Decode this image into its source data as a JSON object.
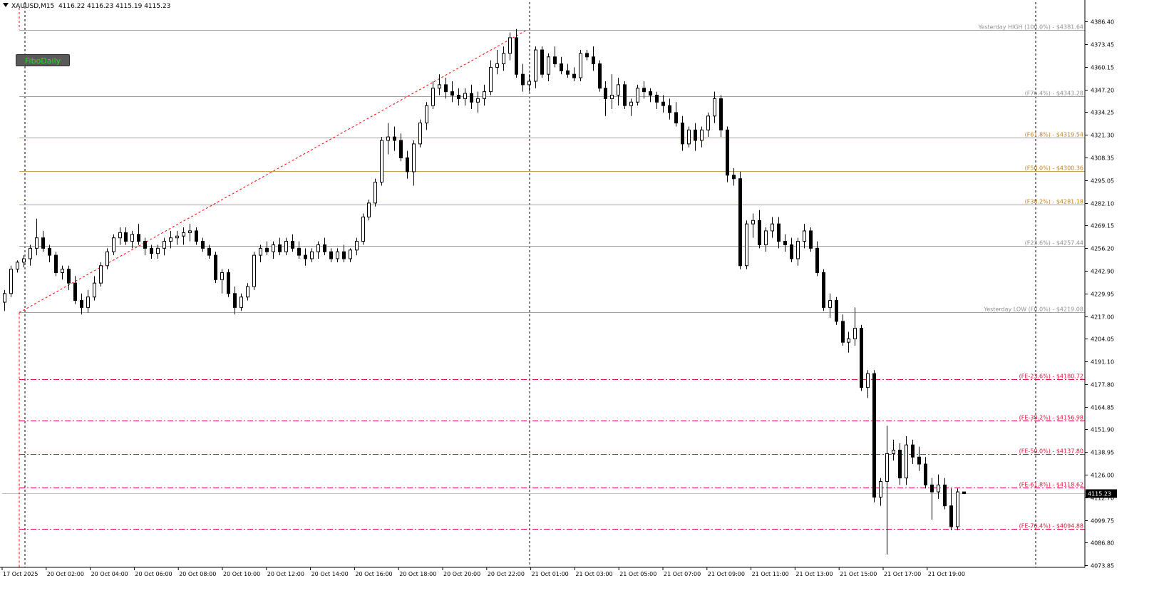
{
  "header": {
    "symbol": "XAUUSD,M15",
    "ohlc": "4116.22 4116.23 4115.19 4115.23"
  },
  "button": {
    "label": "FiboDaily"
  },
  "colors": {
    "background": "#ffffff",
    "gray_line": "#a0a0a0",
    "gold_line": "#c8a050",
    "fe_line": "#dc143c",
    "trend": "#ff0000",
    "bull": "#ffffff",
    "bear": "#000000"
  },
  "chart_data": {
    "type": "candlestick",
    "price_axis": {
      "ticks": [
        "4386.40",
        "4373.45",
        "4360.15",
        "4347.20",
        "4334.25",
        "4321.30",
        "4308.35",
        "4295.05",
        "4282.10",
        "4269.15",
        "4256.20",
        "4242.90",
        "4229.95",
        "4217.00",
        "4204.05",
        "4191.10",
        "4177.80",
        "4164.85",
        "4151.90",
        "4138.95",
        "4126.00",
        "4112.70",
        "4099.75",
        "4086.80",
        "4073.85"
      ],
      "current_price": "4115.23"
    },
    "time_axis": [
      "17 Oct 2025",
      "20 Oct 02:00",
      "20 Oct 04:00",
      "20 Oct 06:00",
      "20 Oct 08:00",
      "20 Oct 10:00",
      "20 Oct 12:00",
      "20 Oct 14:00",
      "20 Oct 16:00",
      "20 Oct 18:00",
      "20 Oct 20:00",
      "20 Oct 22:00",
      "21 Oct 01:00",
      "21 Oct 03:00",
      "21 Oct 05:00",
      "21 Oct 07:00",
      "21 Oct 09:00",
      "21 Oct 11:00",
      "21 Oct 13:00",
      "21 Oct 15:00",
      "21 Oct 17:00",
      "21 Oct 19:00"
    ],
    "levels": [
      {
        "label": "Yesterday HIGH (100.0%) - $4381.64",
        "price": 4381.64,
        "style": "gray"
      },
      {
        "label": "(F76.4%) - $4343.28",
        "price": 4343.28,
        "style": "gray"
      },
      {
        "label": "(F61.8%) - $4319.54",
        "price": 4319.54,
        "style": "gold"
      },
      {
        "label": "(F50.0%) - $4300.36",
        "price": 4300.36,
        "style": "gold"
      },
      {
        "label": "(F38.2%) - $4281.18",
        "price": 4281.18,
        "style": "gold"
      },
      {
        "label": "(F23.6%) - $4257.44",
        "price": 4257.44,
        "style": "gray"
      },
      {
        "label": "Yesterday LOW (F0.0%) - $4219.08",
        "price": 4219.08,
        "style": "gray"
      },
      {
        "label": "(FE-23.6%) - $4180.72",
        "price": 4180.72,
        "style": "fe"
      },
      {
        "label": "(FE-38.2%) - $4156.98",
        "price": 4156.98,
        "style": "fe"
      },
      {
        "label": "(FE-50.0%) - $4137.80",
        "price": 4137.8,
        "style": "fe"
      },
      {
        "label": "(FE-61.8%) - $4118.62",
        "price": 4118.62,
        "style": "fe"
      },
      {
        "label": "(FE-76.4%) - $4094.88",
        "price": 4094.88,
        "style": "fe"
      }
    ],
    "candles": [
      [
        4225,
        4232,
        4220,
        4230
      ],
      [
        4230,
        4246,
        4228,
        4244
      ],
      [
        4244,
        4249,
        4242,
        4248
      ],
      [
        4248,
        4252,
        4245,
        4250
      ],
      [
        4250,
        4258,
        4246,
        4256
      ],
      [
        4256,
        4273,
        4252,
        4262
      ],
      [
        4262,
        4266,
        4254,
        4256
      ],
      [
        4256,
        4258,
        4248,
        4252
      ],
      [
        4252,
        4254,
        4240,
        4242
      ],
      [
        4242,
        4246,
        4238,
        4244
      ],
      [
        4244,
        4246,
        4232,
        4236
      ],
      [
        4236,
        4240,
        4224,
        4226
      ],
      [
        4226,
        4230,
        4218,
        4222
      ],
      [
        4222,
        4232,
        4219,
        4228
      ],
      [
        4228,
        4240,
        4226,
        4236
      ],
      [
        4236,
        4248,
        4234,
        4246
      ],
      [
        4246,
        4256,
        4244,
        4254
      ],
      [
        4254,
        4264,
        4252,
        4262
      ],
      [
        4262,
        4268,
        4258,
        4265
      ],
      [
        4265,
        4268,
        4258,
        4260
      ],
      [
        4260,
        4266,
        4256,
        4264
      ],
      [
        4264,
        4270,
        4258,
        4260
      ],
      [
        4260,
        4262,
        4252,
        4256
      ],
      [
        4256,
        4258,
        4250,
        4253
      ],
      [
        4253,
        4258,
        4250,
        4256
      ],
      [
        4256,
        4262,
        4252,
        4260
      ],
      [
        4260,
        4266,
        4256,
        4262
      ],
      [
        4262,
        4266,
        4258,
        4263
      ],
      [
        4263,
        4268,
        4258,
        4265
      ],
      [
        4265,
        4270,
        4260,
        4266
      ],
      [
        4266,
        4268,
        4258,
        4260
      ],
      [
        4260,
        4262,
        4254,
        4256
      ],
      [
        4256,
        4258,
        4250,
        4252
      ],
      [
        4252,
        4254,
        4236,
        4238
      ],
      [
        4238,
        4244,
        4230,
        4242
      ],
      [
        4242,
        4244,
        4228,
        4230
      ],
      [
        4230,
        4234,
        4218,
        4222
      ],
      [
        4222,
        4230,
        4220,
        4228
      ],
      [
        4228,
        4236,
        4226,
        4234
      ],
      [
        4234,
        4254,
        4232,
        4252
      ],
      [
        4252,
        4258,
        4248,
        4256
      ],
      [
        4256,
        4260,
        4252,
        4254
      ],
      [
        4254,
        4260,
        4250,
        4258
      ],
      [
        4258,
        4262,
        4252,
        4254
      ],
      [
        4254,
        4262,
        4252,
        4260
      ],
      [
        4260,
        4264,
        4254,
        4256
      ],
      [
        4256,
        4260,
        4250,
        4252
      ],
      [
        4252,
        4256,
        4246,
        4250
      ],
      [
        4250,
        4256,
        4248,
        4254
      ],
      [
        4254,
        4260,
        4250,
        4258
      ],
      [
        4258,
        4262,
        4252,
        4254
      ],
      [
        4254,
        4256,
        4248,
        4250
      ],
      [
        4250,
        4256,
        4248,
        4254
      ],
      [
        4254,
        4258,
        4248,
        4250
      ],
      [
        4250,
        4256,
        4248,
        4255
      ],
      [
        4255,
        4262,
        4252,
        4260
      ],
      [
        4260,
        4276,
        4258,
        4274
      ],
      [
        4274,
        4284,
        4272,
        4282
      ],
      [
        4282,
        4296,
        4280,
        4294
      ],
      [
        4294,
        4320,
        4292,
        4318
      ],
      [
        4318,
        4328,
        4310,
        4320
      ],
      [
        4320,
        4326,
        4312,
        4318
      ],
      [
        4318,
        4322,
        4306,
        4308
      ],
      [
        4308,
        4312,
        4296,
        4300
      ],
      [
        4300,
        4318,
        4292,
        4316
      ],
      [
        4316,
        4330,
        4314,
        4328
      ],
      [
        4328,
        4340,
        4324,
        4338
      ],
      [
        4338,
        4352,
        4336,
        4348
      ],
      [
        4348,
        4356,
        4344,
        4350
      ],
      [
        4350,
        4354,
        4342,
        4346
      ],
      [
        4346,
        4352,
        4340,
        4344
      ],
      [
        4344,
        4348,
        4338,
        4342
      ],
      [
        4342,
        4348,
        4338,
        4345
      ],
      [
        4345,
        4350,
        4336,
        4340
      ],
      [
        4340,
        4346,
        4334,
        4342
      ],
      [
        4342,
        4350,
        4338,
        4346
      ],
      [
        4346,
        4364,
        4344,
        4360
      ],
      [
        4360,
        4370,
        4356,
        4362
      ],
      [
        4362,
        4372,
        4358,
        4368
      ],
      [
        4368,
        4380,
        4364,
        4377
      ],
      [
        4377,
        4382,
        4354,
        4356
      ],
      [
        4356,
        4362,
        4346,
        4350
      ],
      [
        4350,
        4356,
        4346,
        4352
      ],
      [
        4352,
        4372,
        4348,
        4370
      ],
      [
        4370,
        4372,
        4354,
        4356
      ],
      [
        4356,
        4368,
        4352,
        4366
      ],
      [
        4366,
        4372,
        4360,
        4362
      ],
      [
        4362,
        4366,
        4356,
        4358
      ],
      [
        4358,
        4362,
        4354,
        4356
      ],
      [
        4356,
        4360,
        4352,
        4354
      ],
      [
        4354,
        4370,
        4352,
        4368
      ],
      [
        4368,
        4370,
        4364,
        4366
      ],
      [
        4366,
        4372,
        4358,
        4362
      ],
      [
        4362,
        4364,
        4346,
        4348
      ],
      [
        4348,
        4352,
        4332,
        4342
      ],
      [
        4342,
        4356,
        4336,
        4344
      ],
      [
        4344,
        4354,
        4338,
        4350
      ],
      [
        4350,
        4352,
        4336,
        4338
      ],
      [
        4338,
        4342,
        4332,
        4340
      ],
      [
        4340,
        4350,
        4338,
        4348
      ],
      [
        4348,
        4352,
        4342,
        4346
      ],
      [
        4346,
        4348,
        4340,
        4344
      ],
      [
        4344,
        4346,
        4336,
        4340
      ],
      [
        4340,
        4344,
        4334,
        4338
      ],
      [
        4338,
        4342,
        4330,
        4334
      ],
      [
        4334,
        4340,
        4326,
        4328
      ],
      [
        4328,
        4332,
        4312,
        4316
      ],
      [
        4316,
        4326,
        4314,
        4324
      ],
      [
        4324,
        4328,
        4312,
        4318
      ],
      [
        4318,
        4326,
        4314,
        4324
      ],
      [
        4324,
        4334,
        4320,
        4332
      ],
      [
        4332,
        4346,
        4328,
        4342
      ],
      [
        4342,
        4344,
        4320,
        4324
      ],
      [
        4324,
        4326,
        4294,
        4298
      ],
      [
        4298,
        4302,
        4292,
        4296
      ],
      [
        4296,
        4300,
        4244,
        4246
      ],
      [
        4246,
        4272,
        4244,
        4270
      ],
      [
        4270,
        4276,
        4262,
        4272
      ],
      [
        4272,
        4278,
        4256,
        4258
      ],
      [
        4258,
        4268,
        4254,
        4266
      ],
      [
        4266,
        4274,
        4262,
        4270
      ],
      [
        4270,
        4274,
        4256,
        4260
      ],
      [
        4260,
        4264,
        4254,
        4258
      ],
      [
        4258,
        4262,
        4248,
        4250
      ],
      [
        4250,
        4262,
        4246,
        4260
      ],
      [
        4260,
        4270,
        4256,
        4266
      ],
      [
        4266,
        4268,
        4254,
        4256
      ],
      [
        4256,
        4260,
        4240,
        4242
      ],
      [
        4242,
        4244,
        4220,
        4222
      ],
      [
        4222,
        4230,
        4216,
        4226
      ],
      [
        4226,
        4228,
        4212,
        4214
      ],
      [
        4214,
        4218,
        4200,
        4202
      ],
      [
        4202,
        4208,
        4196,
        4204
      ],
      [
        4204,
        4222,
        4200,
        4210
      ],
      [
        4210,
        4212,
        4174,
        4176
      ],
      [
        4176,
        4186,
        4170,
        4184
      ],
      [
        4184,
        4186,
        4110,
        4113
      ],
      [
        4113,
        4124,
        4108,
        4122
      ],
      [
        4122,
        4154,
        4080,
        4138
      ],
      [
        4138,
        4146,
        4134,
        4140
      ],
      [
        4140,
        4144,
        4120,
        4124
      ],
      [
        4124,
        4148,
        4120,
        4143
      ],
      [
        4143,
        4146,
        4132,
        4136
      ],
      [
        4136,
        4142,
        4128,
        4132
      ],
      [
        4132,
        4136,
        4118,
        4120
      ],
      [
        4120,
        4124,
        4100,
        4116
      ],
      [
        4116,
        4126,
        4112,
        4120
      ],
      [
        4120,
        4124,
        4106,
        4108
      ],
      [
        4108,
        4118,
        4094,
        4096
      ],
      [
        4096,
        4118,
        4094,
        4116
      ],
      [
        4116,
        4116,
        4115,
        4115
      ]
    ]
  }
}
